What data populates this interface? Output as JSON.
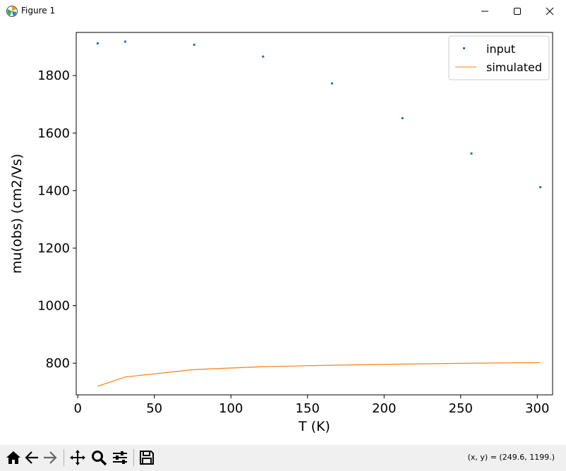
{
  "window": {
    "title": "Figure 1",
    "buttons": [
      "minimize",
      "maximize",
      "close"
    ]
  },
  "toolbar": {
    "tools": [
      "home-icon",
      "back-icon",
      "forward-icon",
      "pan-icon",
      "zoom-icon",
      "configure-icon",
      "save-icon"
    ],
    "coords": "(x, y) = (249.6, 1199.)"
  },
  "colors": {
    "input": "#1f77b4",
    "simulated": "#ff7f0e"
  },
  "chart_data": {
    "type": "scatter",
    "xlabel": "T (K)",
    "ylabel": "mu(obs) (cm2/Vs)",
    "xlim": [
      -1,
      310
    ],
    "ylim": [
      690,
      1950
    ],
    "xticks": [
      0,
      50,
      100,
      150,
      200,
      250,
      300
    ],
    "yticks": [
      800,
      1000,
      1200,
      1400,
      1600,
      1800
    ],
    "legend_position": "top-right",
    "series": [
      {
        "name": "input",
        "style": "points",
        "x": [
          13,
          31,
          76,
          121,
          166,
          212,
          257,
          302
        ],
        "y": [
          1912,
          1918,
          1907,
          1866,
          1773,
          1652,
          1529,
          1412
        ]
      },
      {
        "name": "simulated",
        "style": "line",
        "x": [
          13,
          31,
          76,
          121,
          166,
          212,
          257,
          302
        ],
        "y": [
          720,
          752,
          778,
          788,
          793,
          797,
          800,
          802
        ]
      }
    ]
  }
}
